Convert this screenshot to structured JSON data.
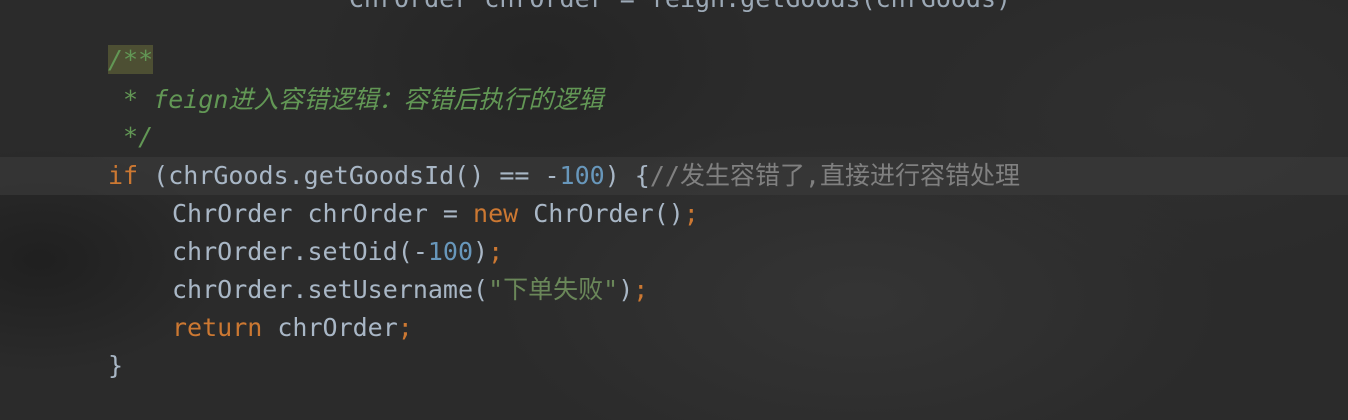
{
  "editor": {
    "colors": {
      "background": "#2b2b2b",
      "keyword": "#cc7832",
      "number": "#6897bb",
      "string": "#6a8759",
      "comment": "#808080",
      "doc_comment": "#629755",
      "identifier": "#a9b7c6",
      "current_line": "#3a3a3a"
    },
    "cut_line": "                ChrOrder chrOrder = feign.getGoods(chrGoods);",
    "lines": [
      {
        "open": "/**"
      },
      {
        "text": " * feign进入容错逻辑：容错后执行的逻辑"
      },
      {
        "text": " */"
      },
      {
        "kw_if": "if",
        "p1": " (chrGoods.getGoodsId() == -",
        "n1": "100",
        "p2": ") {",
        "comment": "//发生容错了,直接进行容错处理"
      },
      {
        "p1": "ChrOrder chrOrder = ",
        "kw_new": "new",
        "p2": " ChrOrder()",
        "semi": ";"
      },
      {
        "p1": "chrOrder.setOid(-",
        "n1": "100",
        "p2": ")",
        "semi": ";"
      },
      {
        "p1": "chrOrder.setUsername(",
        "str": "\"下单失败\"",
        "p2": ")",
        "semi": ";"
      },
      {
        "kw_return": "return",
        "p1": " chrOrder",
        "semi": ";"
      },
      {
        "text": "}"
      }
    ]
  }
}
